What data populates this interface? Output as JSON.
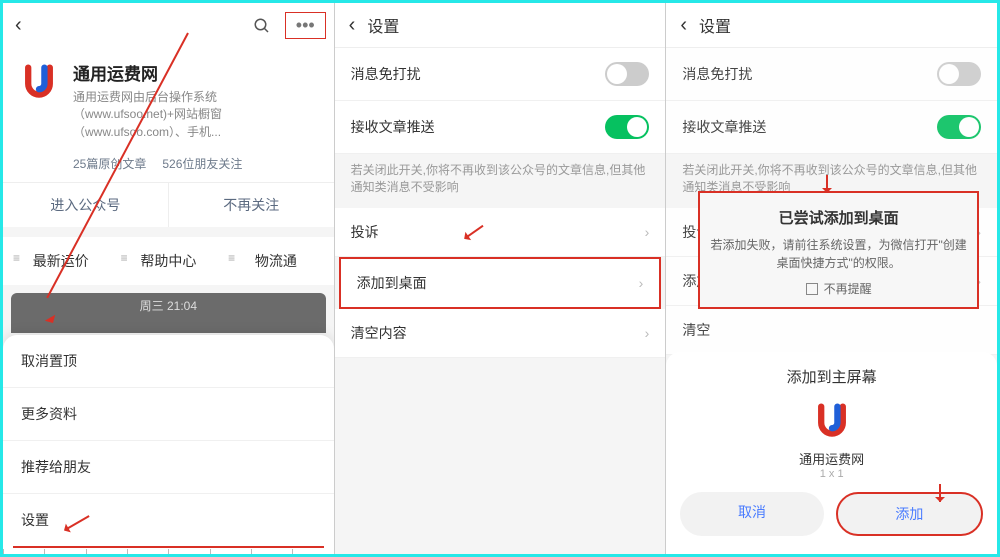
{
  "panel1": {
    "profile_name": "通用运费网",
    "profile_desc": "通用运费网由后台操作系统（www.ufsoo.net)+网站橱窗（www.ufsoo.com）、手机...",
    "stats_articles": "25篇原创文章",
    "stats_followers": "526位朋友关注",
    "btn_enter": "进入公众号",
    "btn_unfollow": "不再关注",
    "tab_latest": "最新运价",
    "tab_help": "帮助中心",
    "tab_logistics": "物流通",
    "banner_time": "周三 21:04",
    "sheet_unpin": "取消置顶",
    "sheet_more": "更多资料",
    "sheet_recommend": "推荐给朋友",
    "sheet_settings": "设置"
  },
  "panel2": {
    "title": "设置",
    "row_dnd": "消息免打扰",
    "row_push": "接收文章推送",
    "push_hint": "若关闭此开关,你将不再收到该公众号的文章信息,但其他通知类消息不受影响",
    "row_complain": "投诉",
    "row_addhome": "添加到桌面",
    "row_clear": "清空内容"
  },
  "panel3": {
    "title": "设置",
    "row_dnd": "消息免打扰",
    "row_push": "接收文章推送",
    "push_hint": "若关闭此开关,你将不再收到该公众号的文章信息,但其他通知类消息不受影响",
    "row_complain_short": "投诉",
    "row_addhome_short": "添加",
    "row_clear_short": "清空",
    "toast_title": "已尝试添加到桌面",
    "toast_msg": "若添加失败，请前往系统设置，为微信打开\"创建桌面快捷方式\"的权限。",
    "toast_noremind": "不再提醒",
    "sheet_title": "添加到主屏幕",
    "app_name": "通用运费网",
    "app_size": "1 x 1",
    "btn_cancel": "取消",
    "btn_add": "添加"
  }
}
